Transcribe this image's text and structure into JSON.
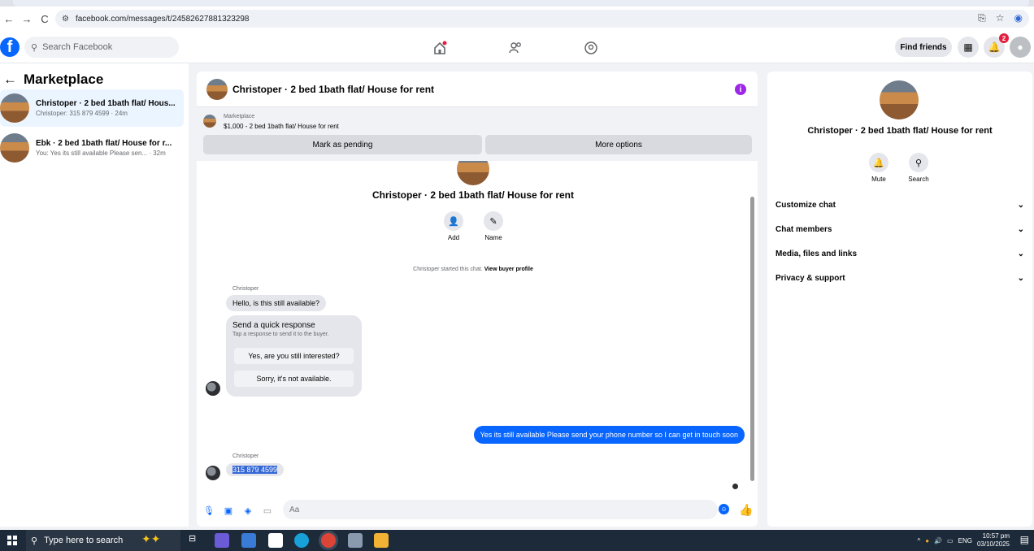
{
  "browser": {
    "url": "facebook.com/messages/t/24582627881323298"
  },
  "header": {
    "search_placeholder": "Search Facebook",
    "find_friends": "Find friends",
    "notif_count": "2"
  },
  "sidebar": {
    "title": "Marketplace",
    "items": [
      {
        "title": "Christoper · 2 bed 1bath flat/ Hous...",
        "subtitle": "Christoper: 315 879 4599 · 24m"
      },
      {
        "title": "Ebk · 2 bed 1bath flat/ House for r...",
        "subtitle": "You: Yes its still available Please sen... · 32m"
      }
    ]
  },
  "chat": {
    "title": "Christoper · 2 bed 1bath flat/ House for rent",
    "listing_source": "Marketplace",
    "listing_price": "$1,000 - 2 bed 1bath flat/ House for rent",
    "mark_pending": "Mark as pending",
    "more_options": "More options",
    "intro_name": "Christoper · 2 bed 1bath flat/ House for rent",
    "add_label": "Add",
    "name_label": "Name",
    "started_text": "Christoper started this chat.",
    "view_buyer_profile": "View buyer profile",
    "sender_name": "Christoper",
    "msg_hello": "Hello, is this still available?",
    "quick_title": "Send a quick response",
    "quick_sub": "Tap a response to send it to the buyer.",
    "quick_yes": "Yes, are you still interested?",
    "quick_sorry": "Sorry, it's not available.",
    "msg_out": "Yes its still available Please send your phone number so I can get in touch soon",
    "sender_name_2": "Christoper",
    "msg_phone": "315 879 4599",
    "composer_placeholder": "Aa"
  },
  "right_panel": {
    "name": "Christoper · 2 bed 1bath flat/ House for rent",
    "mute": "Mute",
    "search": "Search",
    "sections": [
      "Customize chat",
      "Chat members",
      "Media, files and links",
      "Privacy & support"
    ]
  },
  "taskbar": {
    "search": "Type here to search",
    "lang": "ENG",
    "time": "10:57 pm",
    "date": "03/10/2025"
  },
  "colors": {
    "accent": "#0866ff",
    "info": "#9c27e8",
    "badge": "#e41e3f"
  }
}
